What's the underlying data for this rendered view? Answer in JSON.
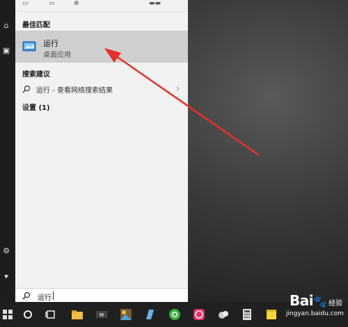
{
  "search_panel": {
    "best_match_title": "最佳匹配",
    "best_match": {
      "name": "运行",
      "type": "桌面应用"
    },
    "suggestions_title": "搜索建议",
    "suggestion": "运行 - 查看网络搜索结果",
    "settings_title": "设置 (1)"
  },
  "search_box": {
    "value": "运行"
  },
  "taskbar": {
    "items": [
      "start-icon",
      "cortana-icon",
      "task-view-icon",
      "edge-icon",
      "file-explorer-icon",
      "media-player-icon",
      "photos-icon",
      "notepad-icon",
      "chrome-icon",
      "game-icon",
      "weather-icon",
      "calculator-icon",
      "sticky-notes-icon"
    ]
  },
  "watermark": {
    "brand": "Bai",
    "brand_suffix": "经验",
    "url": "jingyan.baidu.com"
  },
  "colors": {
    "accent_arrow": "#e8302a",
    "panel_bg": "#f2f2f2",
    "highlight": "#cfcfcf"
  }
}
